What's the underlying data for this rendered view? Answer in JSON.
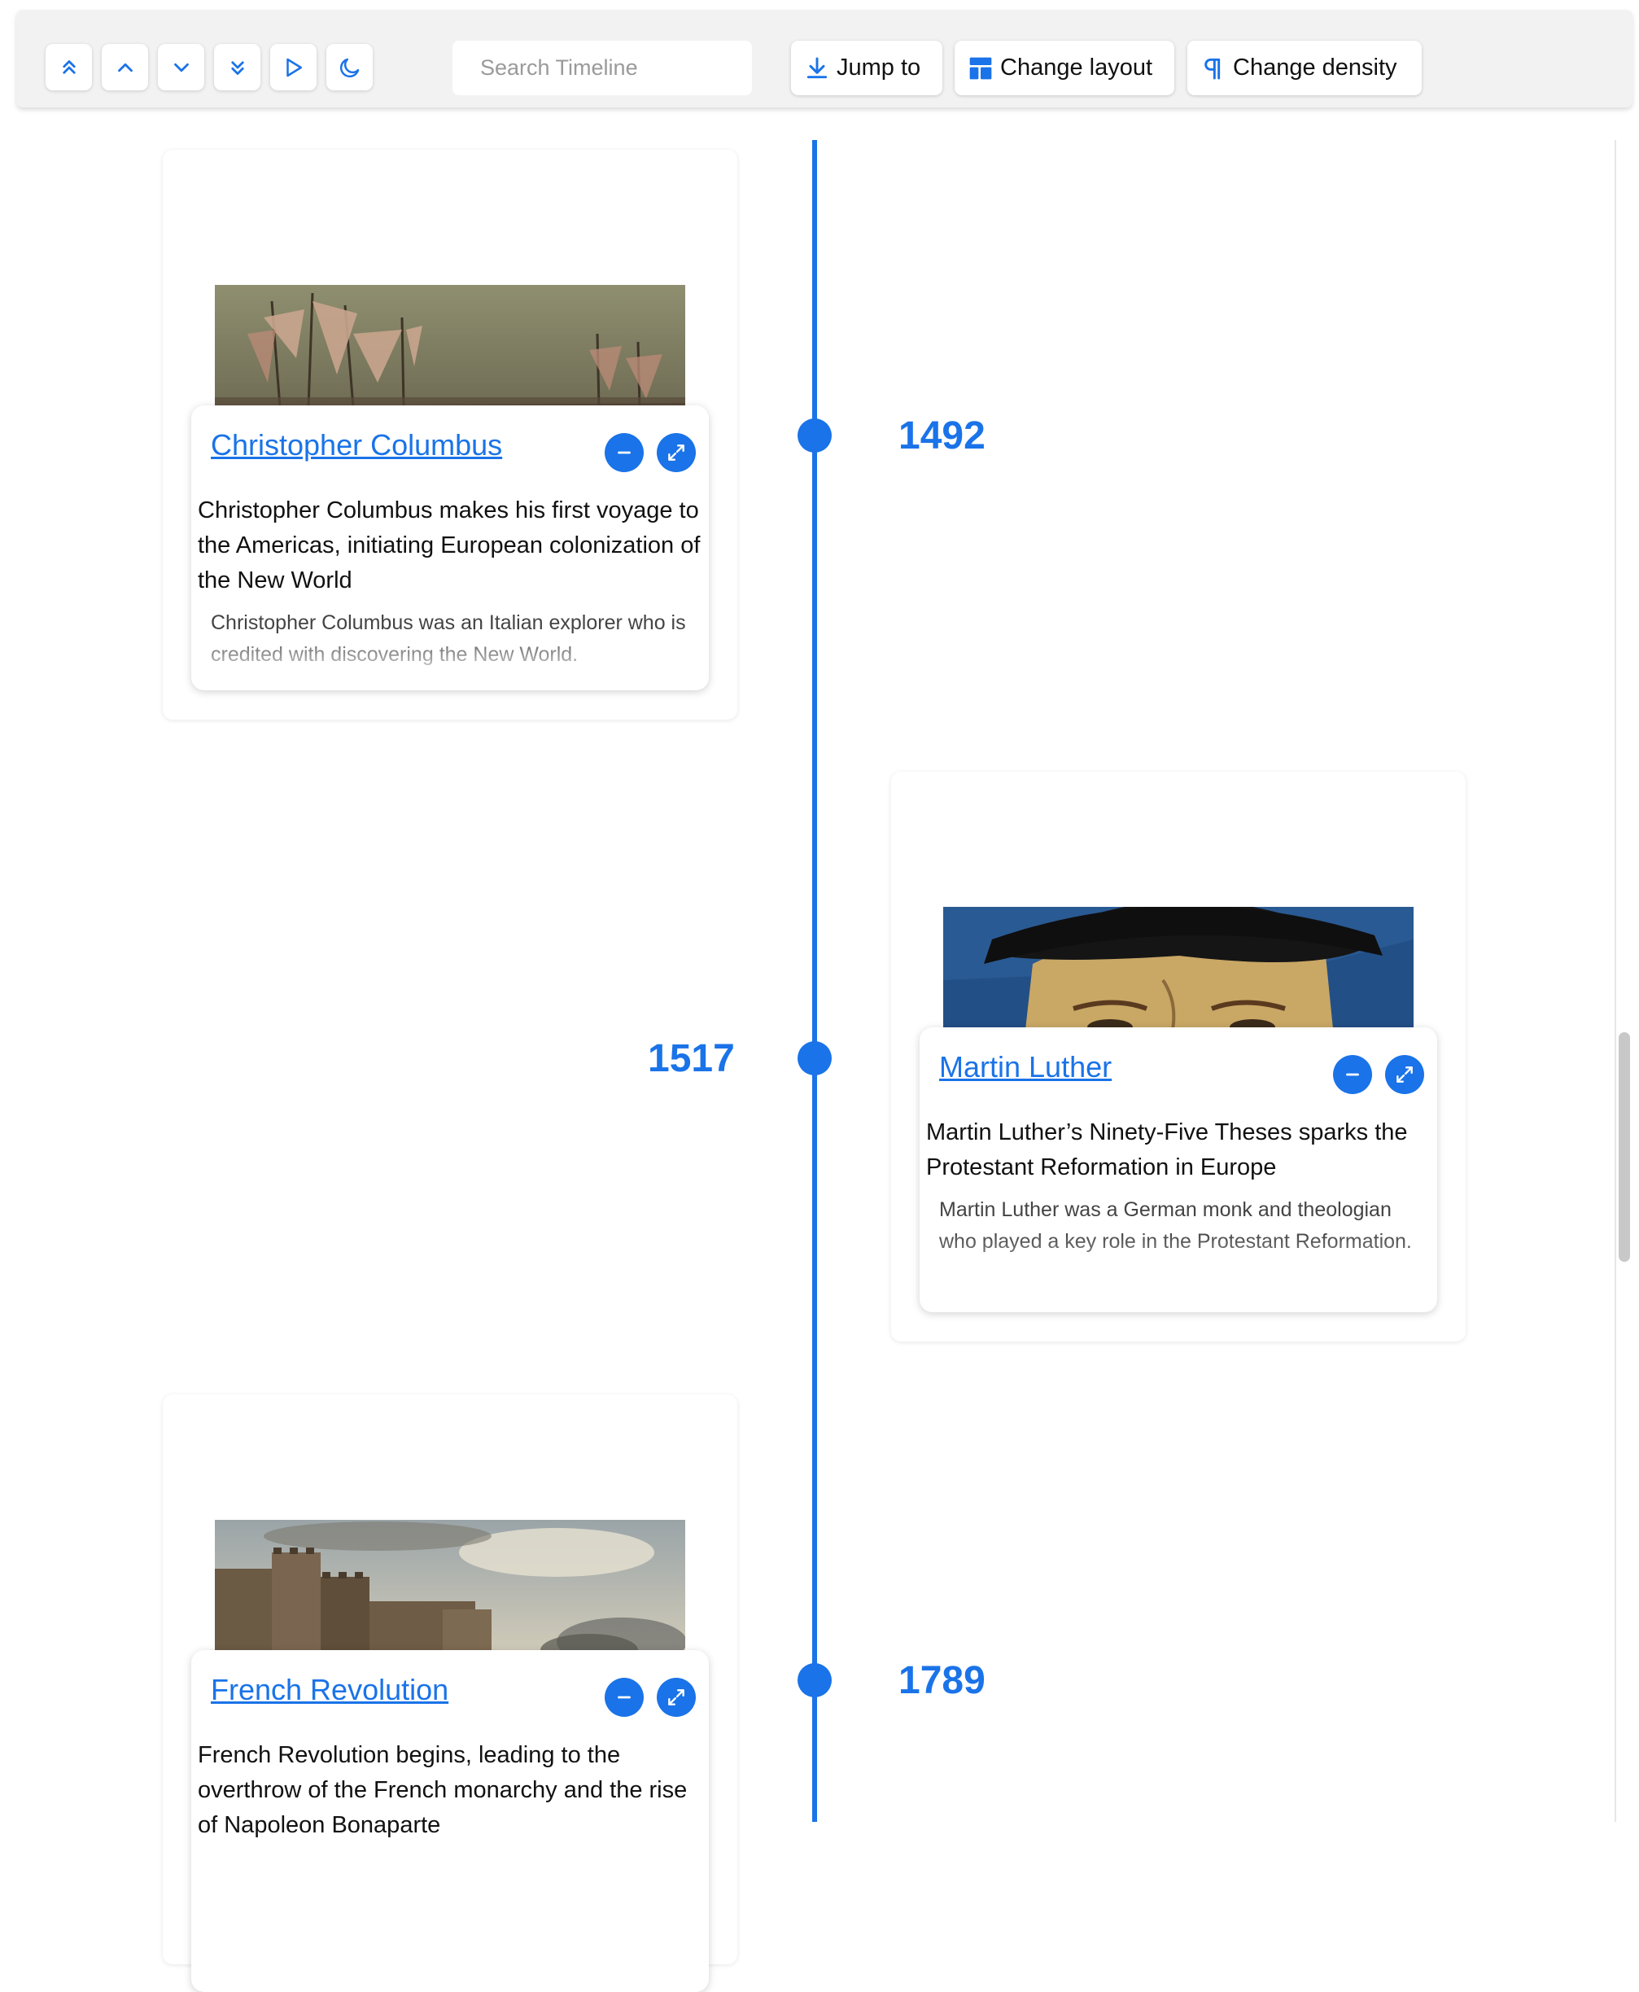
{
  "toolbar": {
    "search": {
      "placeholder": "Search Timeline",
      "value": ""
    },
    "jump_to_label": "Jump to",
    "change_layout_label": "Change layout",
    "change_density_label": "Change density"
  },
  "timeline": {
    "items": [
      {
        "year": "1492",
        "title": "Christopher Columbus",
        "subtitle": "Christopher Columbus makes his first voyage to the Americas, initiating European colonization of the New World",
        "detail": "Christopher Columbus was an Italian explorer who is credited with discovering the New World."
      },
      {
        "year": "1517",
        "title": "Martin Luther",
        "subtitle": "Martin Luther’s Ninety-Five Theses sparks the Protestant Reformation in Europe",
        "detail": "Martin Luther was a German monk and theologian who played a key role in the Protestant Reformation."
      },
      {
        "year": "1789",
        "title": "French Revolution",
        "subtitle": "French Revolution begins, leading to the overthrow of the French monarchy and the rise of Napoleon Bonaparte",
        "detail": ""
      }
    ]
  },
  "colors": {
    "accent": "#1a73e8",
    "toolbar_bg": "#f2f2f2"
  },
  "icons": [
    "chevrons-up-icon",
    "chevron-up-icon",
    "chevron-down-icon",
    "chevrons-down-icon",
    "play-icon",
    "moon-icon",
    "download-icon",
    "layout-icon",
    "paragraph-icon",
    "minus-icon",
    "expand-icon"
  ]
}
